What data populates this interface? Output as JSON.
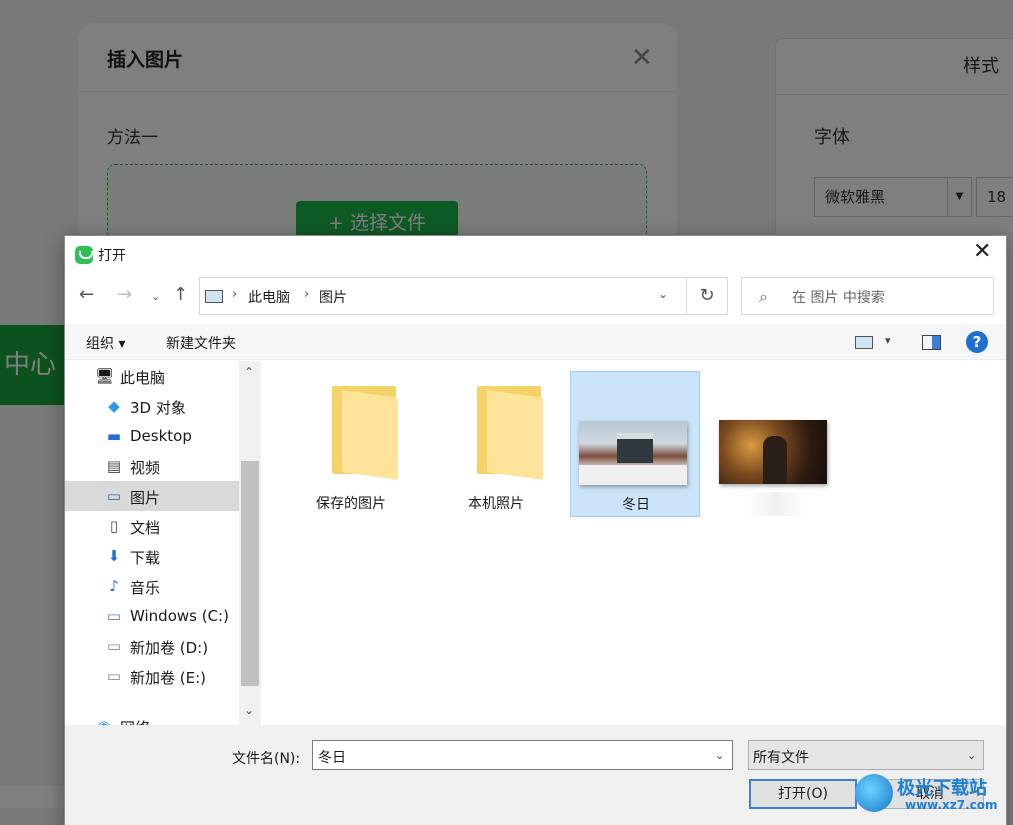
{
  "background_app": {
    "side_tab_label": "中心",
    "right_panel": {
      "header": "样式",
      "font_label": "字体",
      "font_value": "微软雅黑",
      "font_size": "18"
    }
  },
  "insert_modal": {
    "title": "插入图片",
    "close_glyph": "✕",
    "method_label": "方法一",
    "choose_button": "+ 选择文件"
  },
  "dialog": {
    "title": "打开",
    "close_glyph": "✕",
    "nav": {
      "back": "←",
      "forward": "→",
      "recent": "⌄",
      "up": "↑",
      "refresh": "↻"
    },
    "address": {
      "sep": "›",
      "crumbs": [
        "此电脑",
        "图片"
      ],
      "dropdown": "⌄"
    },
    "search_placeholder": "在 图片 中搜索",
    "commands": {
      "organize": "组织 ▾",
      "new_folder": "新建文件夹",
      "view_dropdown": "▾",
      "help": "?"
    },
    "nav_pane": [
      {
        "label": "此电脑",
        "icon": "computer-icon",
        "glyph": "🖥"
      },
      {
        "label": "3D 对象",
        "icon": "cube-icon",
        "glyph": "◆"
      },
      {
        "label": "Desktop",
        "icon": "desktop-icon",
        "glyph": "▬"
      },
      {
        "label": "视频",
        "icon": "video-icon",
        "glyph": "▤"
      },
      {
        "label": "图片",
        "icon": "pictures-icon",
        "glyph": "▭",
        "selected": true
      },
      {
        "label": "文档",
        "icon": "document-icon",
        "glyph": "▯"
      },
      {
        "label": "下载",
        "icon": "download-icon",
        "glyph": "⬇"
      },
      {
        "label": "音乐",
        "icon": "music-icon",
        "glyph": "♪"
      },
      {
        "label": "Windows (C:)",
        "icon": "drive-icon",
        "glyph": "▭"
      },
      {
        "label": "新加卷 (D:)",
        "icon": "drive-icon",
        "glyph": "▭"
      },
      {
        "label": "新加卷 (E:)",
        "icon": "drive-icon",
        "glyph": "▭"
      },
      {
        "label": "网络",
        "icon": "network-icon",
        "glyph": "◉"
      }
    ],
    "scroll": {
      "up": "⌃",
      "down": "⌄"
    },
    "files": [
      {
        "name": "保存的图片",
        "kind": "folder"
      },
      {
        "name": "本机照片",
        "kind": "folder"
      },
      {
        "name": "冬日",
        "kind": "image",
        "selected": true
      },
      {
        "name": "",
        "kind": "image"
      }
    ],
    "filename_label": "文件名(N):",
    "filename_value": "冬日",
    "filename_dropdown": "⌄",
    "filetype_value": "所有文件",
    "filetype_dropdown": "⌄",
    "open_button": "打开(O)",
    "cancel_button": "取消"
  },
  "watermark": {
    "name": "极光下载站",
    "url": "www.xz7.com"
  }
}
